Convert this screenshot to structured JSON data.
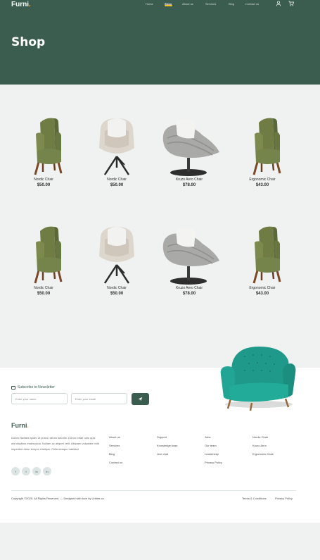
{
  "brand": {
    "name": "Furni",
    "dot": "."
  },
  "nav": {
    "items": [
      {
        "label": "Home",
        "active": false
      },
      {
        "label": "Shop",
        "active": true
      },
      {
        "label": "About us",
        "active": false
      },
      {
        "label": "Services",
        "active": false
      },
      {
        "label": "Blog",
        "active": false
      },
      {
        "label": "Contact us",
        "active": false
      }
    ],
    "icons": [
      "user-icon",
      "cart-icon"
    ]
  },
  "hero": {
    "title": "Shop"
  },
  "products": [
    {
      "name": "Nordic Chair",
      "price": "$50.00",
      "image": "green-armchair"
    },
    {
      "name": "Nordic Chair",
      "price": "$50.00",
      "image": "white-swivel-chair"
    },
    {
      "name": "Kruzo Aero Chair",
      "price": "$78.00",
      "image": "grey-lounge-chair"
    },
    {
      "name": "Ergonomic Chair",
      "price": "$43.00",
      "image": "green-armchair"
    },
    {
      "name": "Nordic Chair",
      "price": "$50.00",
      "image": "green-armchair"
    },
    {
      "name": "Nordic Chair",
      "price": "$50.00",
      "image": "white-swivel-chair"
    },
    {
      "name": "Kruzo Aero Chair",
      "price": "$78.00",
      "image": "grey-lounge-chair"
    },
    {
      "name": "Ergonomic Chair",
      "price": "$43.00",
      "image": "green-armchair"
    }
  ],
  "newsletter": {
    "label": "Subscribe to Newsletter",
    "name_placeholder": "Enter your name",
    "email_placeholder": "Enter your email"
  },
  "footer": {
    "brand": "Furni",
    "about": "Donec facilisis quam ut purus rutrum lobortis. Donec vitae odio quis nisl dapibus malesuada. Nullam ac aliquet velit. Aliquam vulputate velit imperdiet dolor tempor tristique. Pellentesque habitant",
    "social": [
      "facebook-icon",
      "twitter-icon",
      "instagram-icon",
      "linkedin-icon"
    ],
    "social_glyphs": [
      "f",
      "t",
      "in",
      "in"
    ],
    "columns": [
      [
        "About us",
        "Services",
        "Blog",
        "Contact us"
      ],
      [
        "Support",
        "Knowledge base",
        "Live chat"
      ],
      [
        "Jobs",
        "Our team",
        "Leadership",
        "Privacy Policy"
      ],
      [
        "Nordic Chair",
        "Kruzo Aero",
        "Ergonomic Chair"
      ]
    ],
    "copyright": "Copyright ©2025. All Rights Reserved. — Designed with love by Untree.co",
    "terms": "Terms & Conditions",
    "privacy": "Privacy Policy"
  },
  "colors": {
    "primary": "#3b5d50",
    "accent": "#f9bf29",
    "background": "#eff2f1"
  }
}
